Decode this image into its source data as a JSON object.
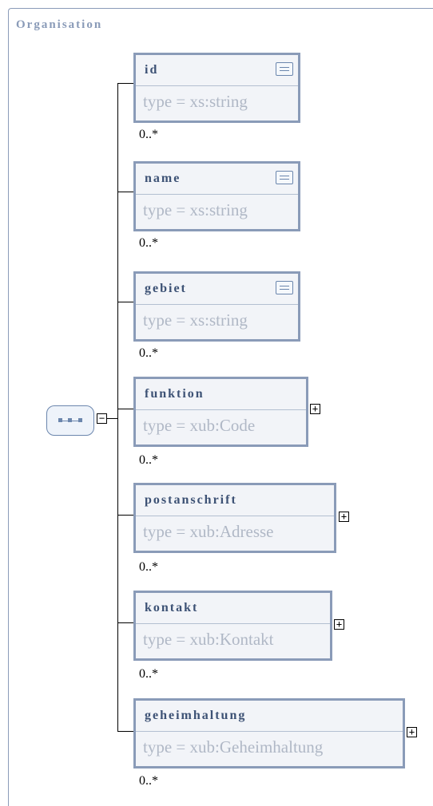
{
  "diagram": {
    "title": "Organisation",
    "elements": [
      {
        "name": "id",
        "type": "type = xs:string",
        "cardinality": "0..*",
        "documented": true,
        "expandable": false
      },
      {
        "name": "name",
        "type": "type = xs:string",
        "cardinality": "0..*",
        "documented": true,
        "expandable": false
      },
      {
        "name": "gebiet",
        "type": "type = xs:string",
        "cardinality": "0..*",
        "documented": true,
        "expandable": false
      },
      {
        "name": "funktion",
        "type": "type = xub:Code",
        "cardinality": "0..*",
        "documented": false,
        "expandable": true
      },
      {
        "name": "postanschrift",
        "type": "type = xub:Adresse",
        "cardinality": "0..*",
        "documented": false,
        "expandable": true
      },
      {
        "name": "kontakt",
        "type": "type = xub:Kontakt",
        "cardinality": "0..*",
        "documented": false,
        "expandable": true
      },
      {
        "name": "geheimhaltung",
        "type": "type = xub:Geheimhaltung",
        "cardinality": "0..*",
        "documented": false,
        "expandable": true
      }
    ],
    "colors": {
      "border": "#8a9bb8",
      "name_text": "#3d5275",
      "type_text": "#b0b8c6",
      "connector": "#000000"
    },
    "icons": {
      "sequence": "sequence-compositor-icon",
      "documentation": "documentation-icon",
      "expand": "plus-box-icon",
      "collapse": "minus-box-icon"
    }
  }
}
